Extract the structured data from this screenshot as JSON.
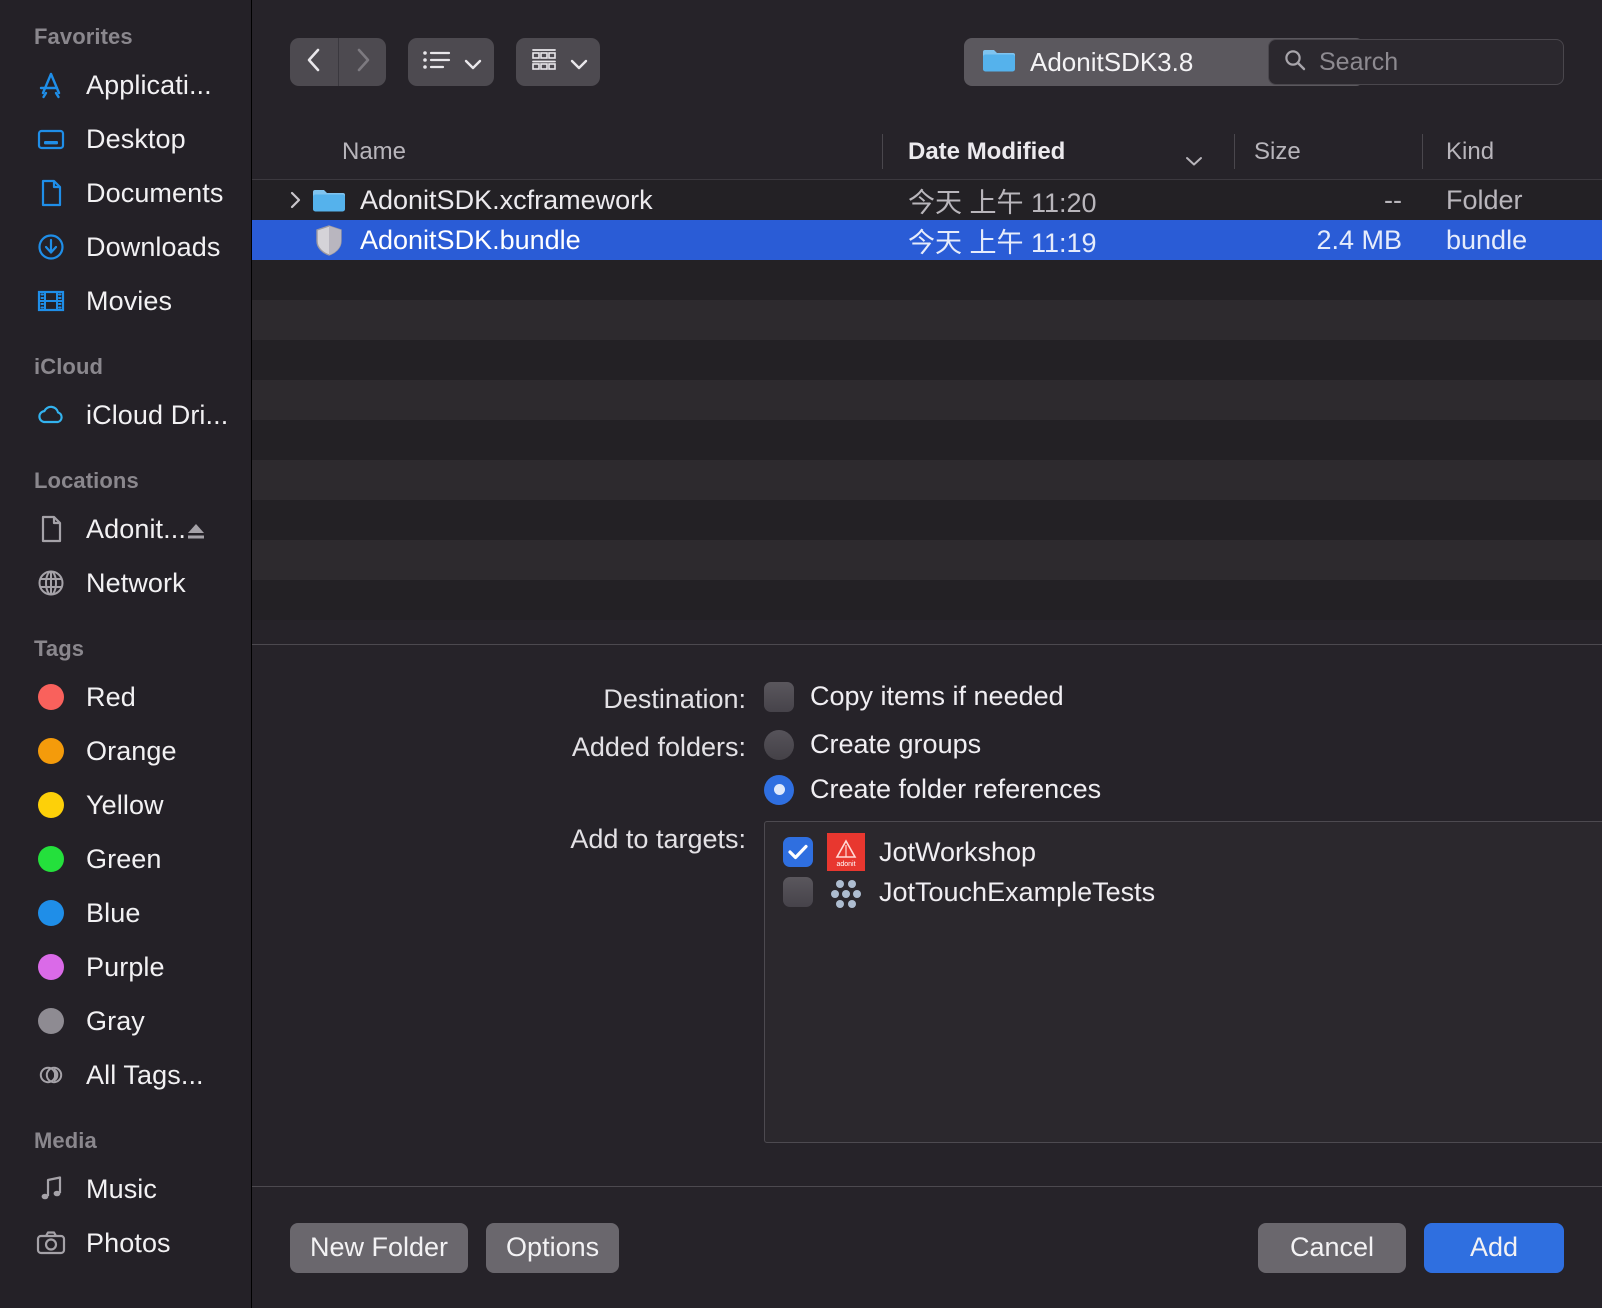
{
  "sidebar": {
    "groups": [
      {
        "title": "Favorites",
        "items": [
          {
            "label": "Applicati...",
            "icon": "appstore-icon"
          },
          {
            "label": "Desktop",
            "icon": "desktop-icon"
          },
          {
            "label": "Documents",
            "icon": "document-icon"
          },
          {
            "label": "Downloads",
            "icon": "download-icon"
          },
          {
            "label": "Movies",
            "icon": "film-icon"
          }
        ]
      },
      {
        "title": "iCloud",
        "items": [
          {
            "label": "iCloud Dri...",
            "icon": "cloud-icon"
          }
        ]
      },
      {
        "title": "Locations",
        "items": [
          {
            "label": "Adonit...",
            "icon": "disk-document-icon",
            "eject": true
          },
          {
            "label": "Network",
            "icon": "globe-icon"
          }
        ]
      },
      {
        "title": "Tags",
        "items": [
          {
            "label": "Red",
            "icon": "tag-dot",
            "color": "#f9615c"
          },
          {
            "label": "Orange",
            "icon": "tag-dot",
            "color": "#f49b0b"
          },
          {
            "label": "Yellow",
            "icon": "tag-dot",
            "color": "#fdd009"
          },
          {
            "label": "Green",
            "icon": "tag-dot",
            "color": "#24e03c"
          },
          {
            "label": "Blue",
            "icon": "tag-dot",
            "color": "#1f8ee8"
          },
          {
            "label": "Purple",
            "icon": "tag-dot",
            "color": "#da6ae8"
          },
          {
            "label": "Gray",
            "icon": "tag-dot",
            "color": "#8e8b92"
          },
          {
            "label": "All Tags...",
            "icon": "all-tags-icon"
          }
        ]
      },
      {
        "title": "Media",
        "items": [
          {
            "label": "Music",
            "icon": "music-note-icon"
          },
          {
            "label": "Photos",
            "icon": "camera-icon"
          }
        ]
      }
    ]
  },
  "toolbar": {
    "back_icon": "chevron-left-icon",
    "forward_icon": "chevron-right-icon",
    "view_mode_icon": "list-view-icon",
    "group_mode_icon": "grid-view-icon",
    "path_label": "AdonitSDK3.8",
    "path_icon": "folder-icon",
    "stepper_icon": "stepper-updown-icon",
    "search_placeholder": "Search",
    "search_value": "",
    "search_icon": "search-icon"
  },
  "columns": {
    "name": "Name",
    "date_modified": "Date Modified",
    "size": "Size",
    "kind": "Kind",
    "sort_indicator_icon": "chevron-down-icon"
  },
  "files": [
    {
      "name": "AdonitSDK.xcframework",
      "date": "今天 上午 11:20",
      "size": "--",
      "kind": "Folder",
      "icon": "folder-icon",
      "expandable": true,
      "selected": false
    },
    {
      "name": "AdonitSDK.bundle",
      "date": "今天 上午 11:19",
      "size": "2.4 MB",
      "kind": "bundle",
      "icon": "bundle-icon",
      "expandable": false,
      "selected": true
    }
  ],
  "options": {
    "destination_label": "Destination:",
    "copy_items_label": "Copy items if needed",
    "copy_items_checked": false,
    "added_folders_label": "Added folders:",
    "create_groups_label": "Create groups",
    "create_groups_selected": false,
    "create_folder_refs_label": "Create folder references",
    "create_folder_refs_selected": true,
    "add_to_targets_label": "Add to targets:",
    "targets": [
      {
        "name": "JotWorkshop",
        "checked": true,
        "icon": "adonit-app-icon",
        "icon_text": "adonit"
      },
      {
        "name": "JotTouchExampleTests",
        "checked": false,
        "icon": "xctest-icon"
      }
    ]
  },
  "bottom": {
    "new_folder_label": "New Folder",
    "options_label": "Options",
    "cancel_label": "Cancel",
    "add_label": "Add"
  },
  "colors": {
    "accent": "#2f6fe0",
    "selection": "#2a5cd6",
    "sidebar_bg": "#242127",
    "main_bg": "#262329"
  }
}
